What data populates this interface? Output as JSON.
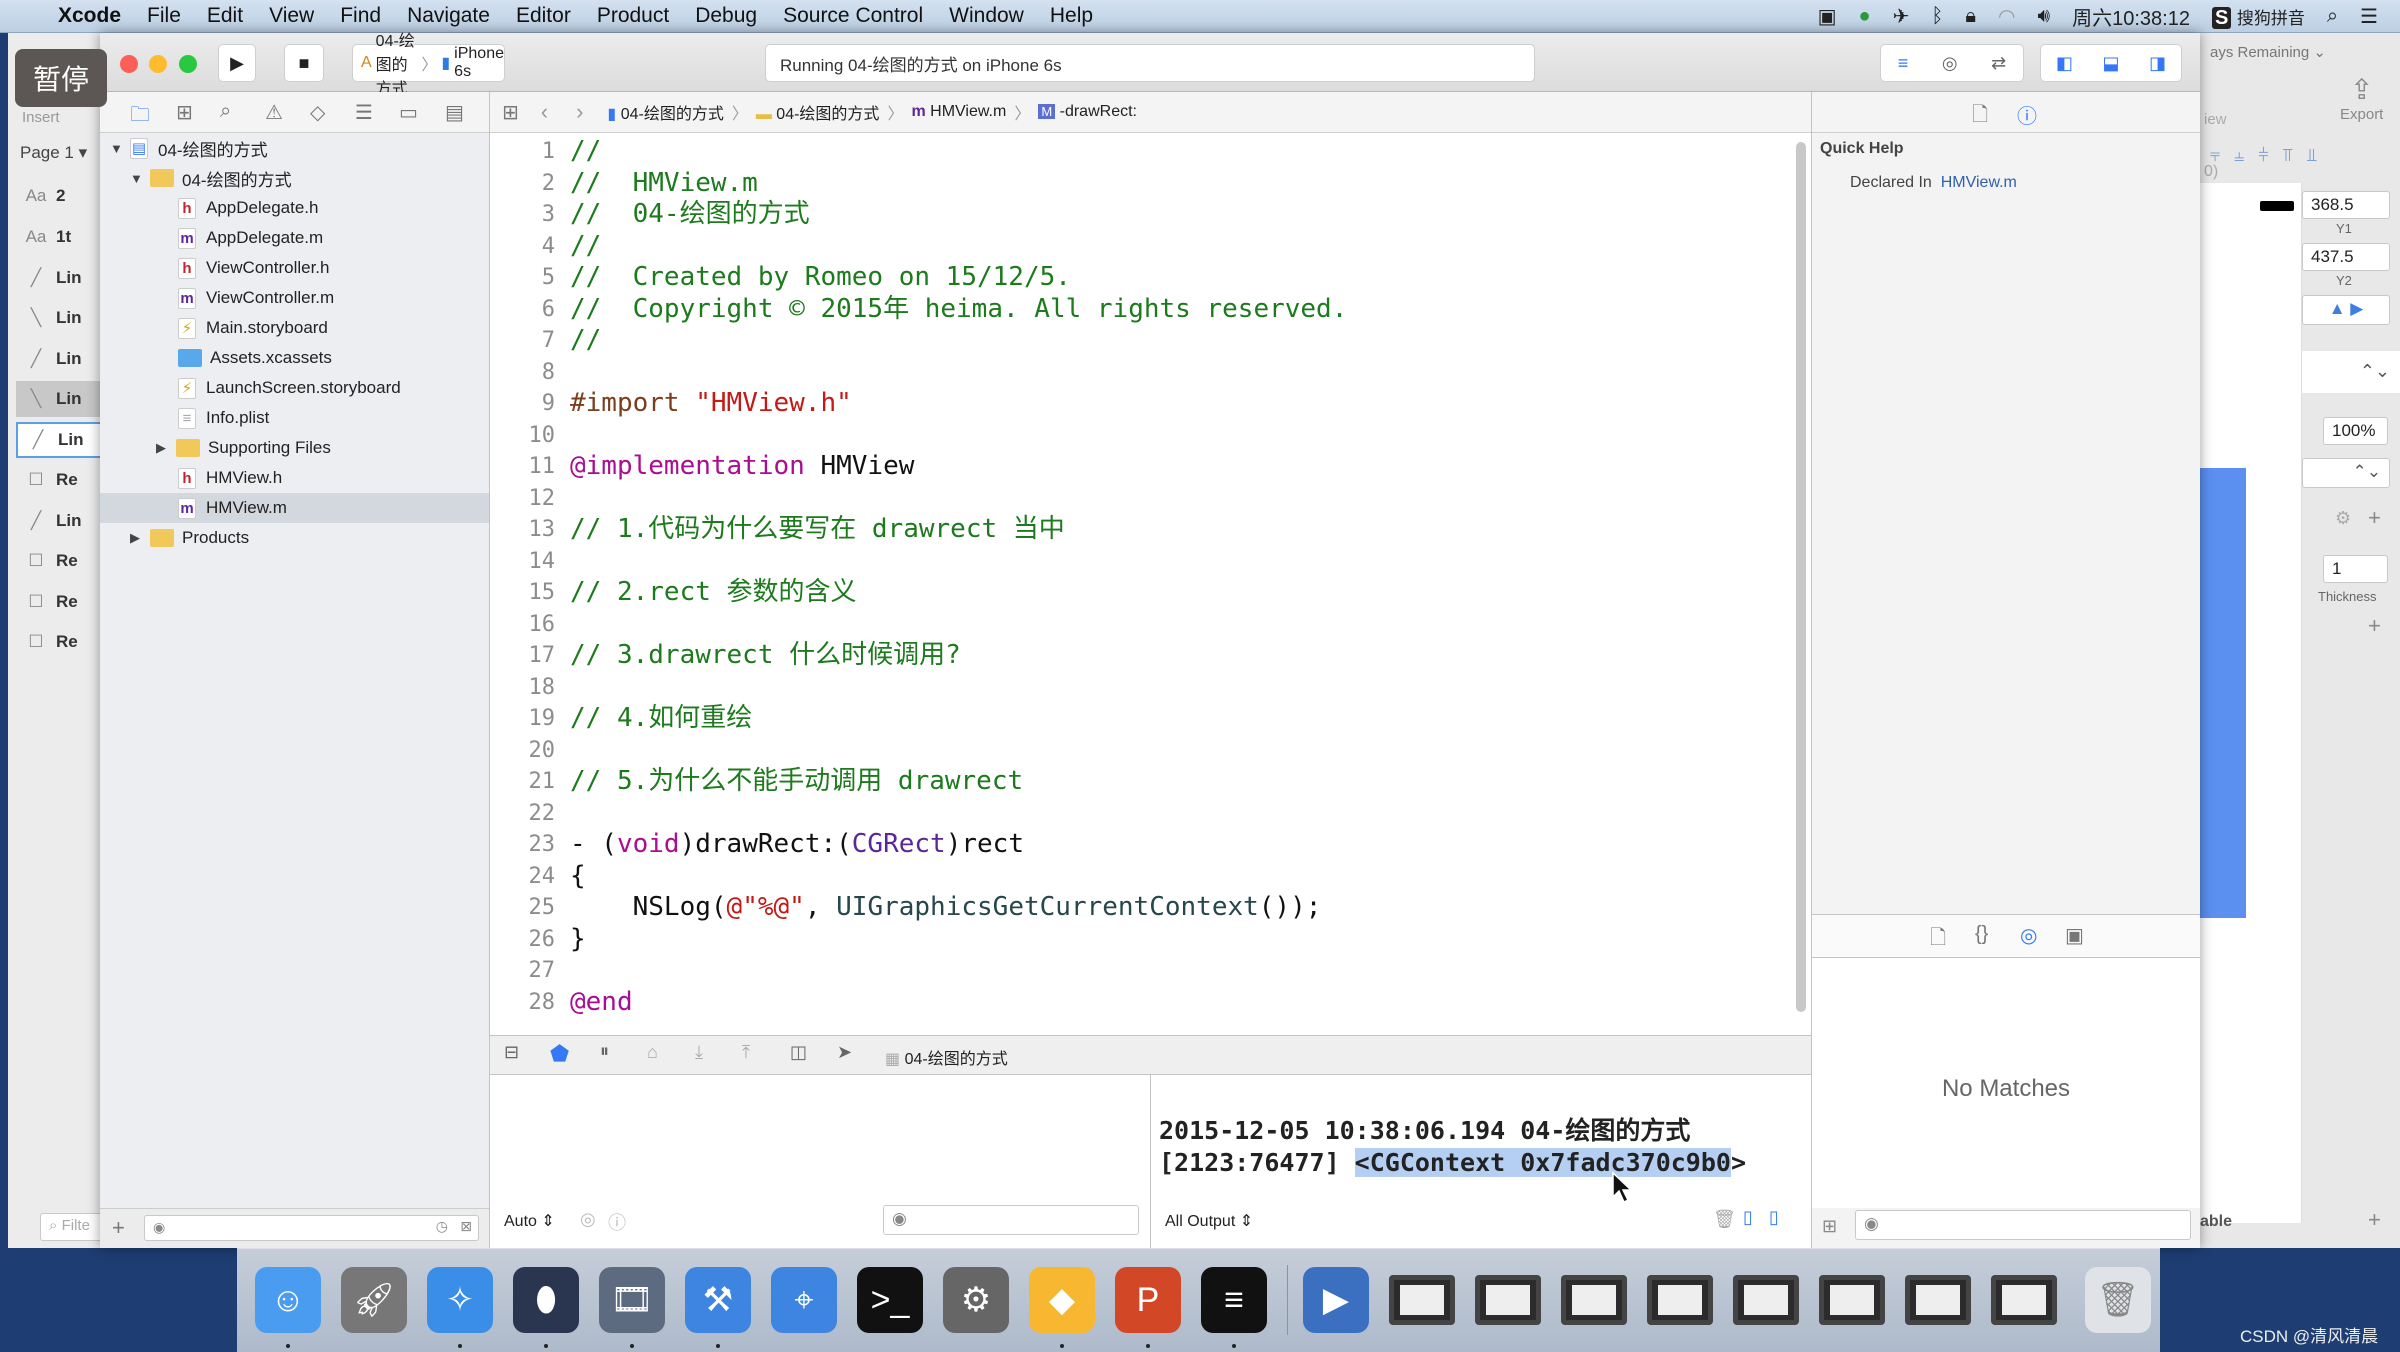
{
  "menubar": {
    "app": "Xcode",
    "items": [
      "File",
      "Edit",
      "View",
      "Find",
      "Navigate",
      "Editor",
      "Product",
      "Debug",
      "Source Control",
      "Window",
      "Help"
    ],
    "clock": "周六10:38:12",
    "input_method": "搜狗拼音"
  },
  "overlay": {
    "pause_label": "暂停"
  },
  "left_app": {
    "insert_label": "Insert",
    "page_select": "Page 1",
    "layers": [
      {
        "icon": "text-icon",
        "label": "2"
      },
      {
        "icon": "text-icon",
        "label": "1t"
      },
      {
        "icon": "line-icon",
        "label": "Lin"
      },
      {
        "icon": "line-icon",
        "label": "Lin"
      },
      {
        "icon": "line-icon",
        "label": "Lin"
      },
      {
        "icon": "line-icon",
        "label": "Lin",
        "selected": true
      },
      {
        "icon": "line-icon",
        "label": "Lin",
        "focused": true
      },
      {
        "icon": "rect-icon",
        "label": "Re"
      },
      {
        "icon": "line-icon",
        "label": "Lin"
      },
      {
        "icon": "rect-icon",
        "label": "Re"
      },
      {
        "icon": "rect-icon",
        "label": "Re"
      },
      {
        "icon": "rect-icon",
        "label": "Re"
      }
    ],
    "filter_placeholder": "Filte"
  },
  "right_app": {
    "trial": "ays Remaining",
    "view_label": "iew",
    "export_label": "Export",
    "count": "0)",
    "y1_value": "368.5",
    "y1_label": "Y1",
    "y2_value": "437.5",
    "y2_label": "Y2",
    "opacity": "100%",
    "thickness_value": "1",
    "thickness_label": "Thickness",
    "bottom_label": "able"
  },
  "toolbar": {
    "scheme": "04-绘图的方式",
    "device": "iPhone 6s",
    "activity": "Running 04-绘图的方式 on iPhone 6s"
  },
  "jumpbar": [
    "04-绘图的方式",
    "04-绘图的方式",
    "HMView.m",
    "-drawRect:"
  ],
  "navigator": {
    "items": [
      {
        "level": 0,
        "type": "project",
        "label": "04-绘图的方式",
        "expanded": true
      },
      {
        "level": 1,
        "type": "folder",
        "label": "04-绘图的方式",
        "expanded": true
      },
      {
        "level": 2,
        "type": "h",
        "label": "AppDelegate.h"
      },
      {
        "level": 2,
        "type": "m",
        "label": "AppDelegate.m"
      },
      {
        "level": 2,
        "type": "h",
        "label": "ViewController.h"
      },
      {
        "level": 2,
        "type": "m",
        "label": "ViewController.m"
      },
      {
        "level": 2,
        "type": "storyboard",
        "label": "Main.storyboard"
      },
      {
        "level": 2,
        "type": "assets",
        "label": "Assets.xcassets"
      },
      {
        "level": 2,
        "type": "storyboard",
        "label": "LaunchScreen.storyboard"
      },
      {
        "level": 2,
        "type": "plist",
        "label": "Info.plist"
      },
      {
        "level": 2,
        "type": "folder",
        "label": "Supporting Files",
        "expanded": false
      },
      {
        "level": 2,
        "type": "h",
        "label": "HMView.h"
      },
      {
        "level": 2,
        "type": "m",
        "label": "HMView.m",
        "selected": true
      },
      {
        "level": 1,
        "type": "folder",
        "label": "Products",
        "expanded": false
      }
    ]
  },
  "code": [
    [
      [
        "cm",
        "//"
      ]
    ],
    [
      [
        "cm",
        "//  HMView.m"
      ]
    ],
    [
      [
        "cm",
        "//  04-绘图的方式"
      ]
    ],
    [
      [
        "cm",
        "//"
      ]
    ],
    [
      [
        "cm",
        "//  Created by Romeo on 15/12/5."
      ]
    ],
    [
      [
        "cm",
        "//  Copyright © 2015年 heima. All rights reserved."
      ]
    ],
    [
      [
        "cm",
        "//"
      ]
    ],
    [],
    [
      [
        "pp",
        "#import "
      ],
      [
        "st",
        "\"HMView.h\""
      ]
    ],
    [],
    [
      [
        "kw",
        "@implementation"
      ],
      [
        "pl",
        " HMView"
      ]
    ],
    [],
    [
      [
        "cm",
        "// 1.代码为什么要写在 drawrect 当中"
      ]
    ],
    [],
    [
      [
        "cm",
        "// 2.rect 参数的含义"
      ]
    ],
    [],
    [
      [
        "cm",
        "// 3.drawrect 什么时候调用?"
      ]
    ],
    [],
    [
      [
        "cm",
        "// 4.如何重绘"
      ]
    ],
    [],
    [
      [
        "cm",
        "// 5.为什么不能手动调用 drawrect"
      ]
    ],
    [],
    [
      [
        "pl",
        "- ("
      ],
      [
        "kw",
        "void"
      ],
      [
        "pl",
        ")drawRect:("
      ],
      [
        "ty",
        "CGRect"
      ],
      [
        "pl",
        ")rect"
      ]
    ],
    [
      [
        "pl",
        "{"
      ]
    ],
    [
      [
        "pl",
        "    NSLog("
      ],
      [
        "st",
        "@\"%@\""
      ],
      [
        "pl",
        ", "
      ],
      [
        "fn",
        "UIGraphicsGetCurrentContext"
      ],
      [
        "pl",
        "());"
      ]
    ],
    [
      [
        "pl",
        "}"
      ]
    ],
    [],
    [
      [
        "kw",
        "@end"
      ]
    ]
  ],
  "debug": {
    "target": "04-绘图的方式",
    "vars_scope": "Auto",
    "output_select": "All Output",
    "console_line1": "2015-12-05 10:38:06.194 04-绘图的方式",
    "console_pid": "[2123:76477] ",
    "console_selected": "<CGContext 0x7fadc370c9b0",
    "console_tail": ">"
  },
  "utilities": {
    "quick_help_title": "Quick Help",
    "declared_in_label": "Declared In",
    "declared_in_value": "HMView.m",
    "no_matches": "No Matches"
  },
  "dock": {
    "apps": [
      "finder-icon",
      "launchpad-icon",
      "safari-icon",
      "mouse-app-icon",
      "movie-icon",
      "xcode-icon",
      "instruments-icon",
      "terminal-icon",
      "system-preferences-icon",
      "sketch-icon",
      "powerpoint-icon",
      "console-icon"
    ],
    "windows": [
      "quicktime-icon",
      "window-thumb-1",
      "window-thumb-2",
      "window-thumb-3",
      "window-thumb-4",
      "window-thumb-5",
      "window-thumb-6",
      "window-thumb-7",
      "window-thumb-8"
    ],
    "trash": "trash-icon"
  },
  "watermark": "CSDN @清风清晨",
  "colors": {
    "accent": "#3478f6",
    "selection": "#b5cff3",
    "comment": "#1d7a1d",
    "keyword": "#aa0d91",
    "string": "#c41a16"
  }
}
